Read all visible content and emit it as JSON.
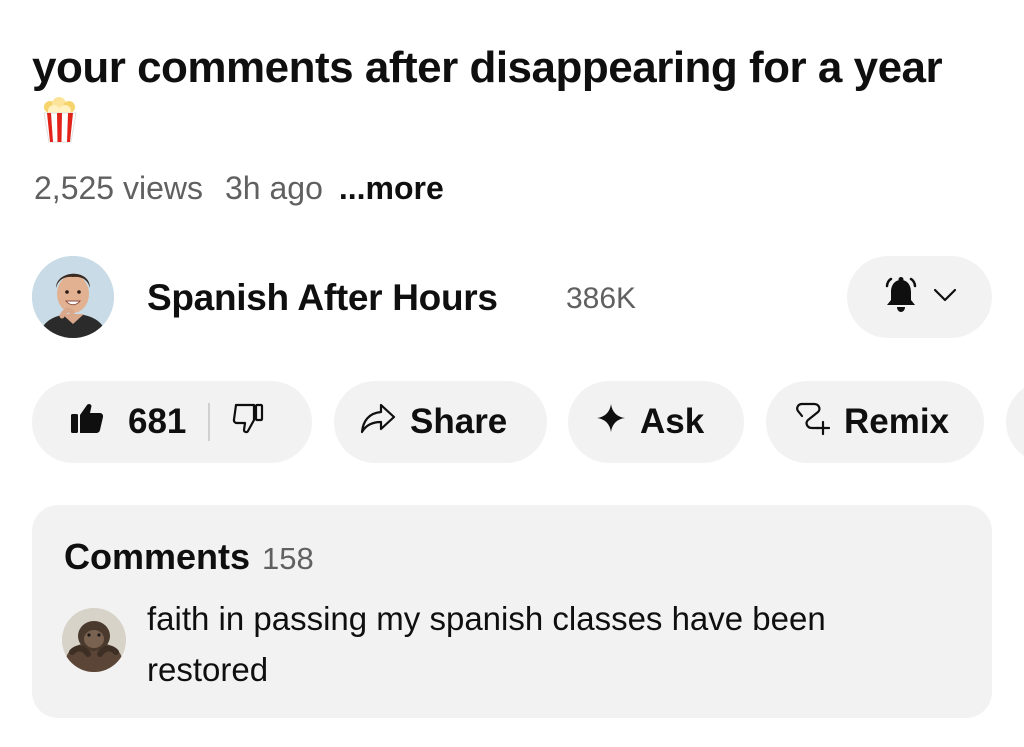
{
  "video": {
    "title": "your comments after disappearing for a year",
    "title_emoji_icon": "popcorn-icon",
    "views": "2,525 views",
    "age": "3h ago",
    "more_label": "...more"
  },
  "channel": {
    "name": "Spanish After Hours",
    "subscribers": "386K",
    "avatar_icon": "channel-avatar",
    "notification_icon": "bell-icon",
    "dropdown_icon": "chevron-down-icon"
  },
  "actions": {
    "like_count": "681",
    "like_icon": "thumbs-up-icon",
    "dislike_icon": "thumbs-down-icon",
    "share_label": "Share",
    "share_icon": "share-arrow-icon",
    "ask_label": "Ask",
    "ask_icon": "sparkle-icon",
    "remix_label": "Remix",
    "remix_icon": "remix-icon"
  },
  "comments": {
    "heading": "Comments",
    "count": "158",
    "top_comment": {
      "text": "faith in passing my spanish classes have been restored",
      "avatar_icon": "commenter-avatar"
    }
  },
  "colors": {
    "text_primary": "#0f0f0f",
    "text_secondary": "#606060",
    "pill_background": "#f2f2f2",
    "page_background": "#ffffff"
  }
}
